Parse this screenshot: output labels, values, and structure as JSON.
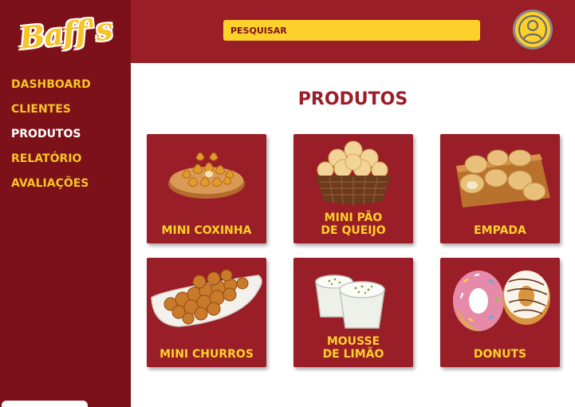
{
  "brand": {
    "logo_text": "Baff's"
  },
  "sidebar": {
    "items": [
      {
        "label": "DASHBOARD"
      },
      {
        "label": "CLIENTES"
      },
      {
        "label": "PRODUTOS",
        "active": true
      },
      {
        "label": "RELATÓRIO"
      },
      {
        "label": "AVALIAÇÕES"
      }
    ]
  },
  "header": {
    "search_placeholder": "PESQUISAR",
    "avatar_icon": "user-icon"
  },
  "main": {
    "title": "PRODUTOS",
    "products": [
      {
        "name": "MINI COXINHA",
        "image": "mini-coxinha-image"
      },
      {
        "name": "MINI PÃO\nDE QUEIJO",
        "image": "mini-pao-de-queijo-image"
      },
      {
        "name": "EMPADA",
        "image": "empada-image"
      },
      {
        "name": "MINI CHURROS",
        "image": "mini-churros-image"
      },
      {
        "name": "MOUSSE\nDE LIMÃO",
        "image": "mousse-de-limao-image"
      },
      {
        "name": "DONUTS",
        "image": "donuts-image"
      }
    ]
  },
  "colors": {
    "sidebar_bg": "#7d1119",
    "header_bg": "#9a1e27",
    "accent_yellow": "#fdd12b",
    "card_bg": "#9a1e27"
  }
}
